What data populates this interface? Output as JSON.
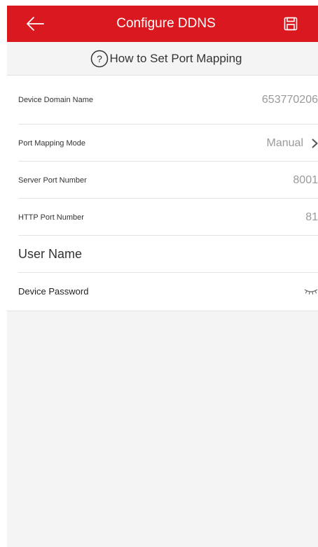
{
  "header": {
    "title": "Configure DDNS",
    "back_icon": "arrow-left-icon",
    "save_icon": "save-icon"
  },
  "help": {
    "icon": "question-circle-icon",
    "label": "How to Set Port Mapping"
  },
  "fields": {
    "domain_label": "Device Domain Name",
    "domain_value": "653770206",
    "mode_label": "Port Mapping Mode",
    "mode_value": "Manual",
    "server_port_label": "Server Port Number",
    "server_port_value": "8001",
    "http_port_label": "HTTP Port Number",
    "http_port_value": "81",
    "username_placeholder": "User Name",
    "password_placeholder": "Device Password"
  },
  "colors": {
    "accent": "#d9191f",
    "background": "#f4f4f4"
  }
}
